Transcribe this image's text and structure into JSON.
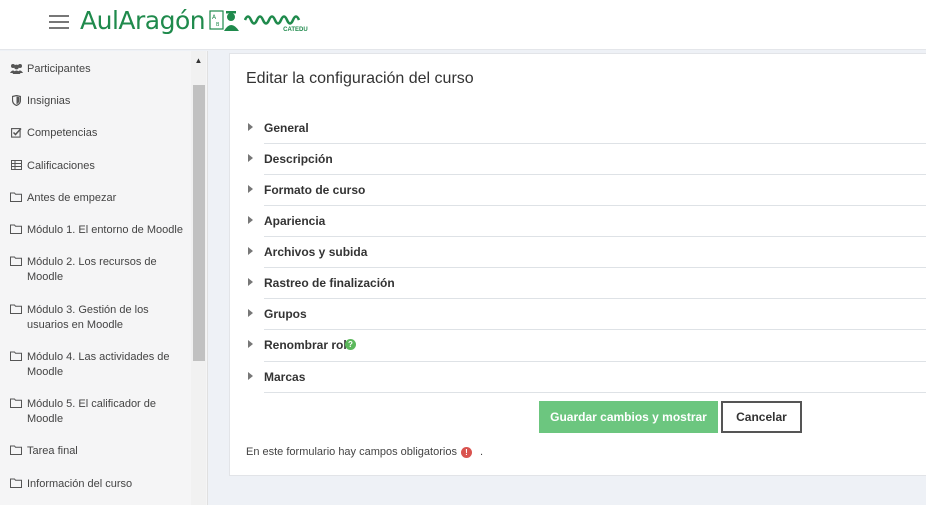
{
  "header": {
    "logo_text": "AulAragón",
    "logo_sub": "CATEDU",
    "menu_icon": "hamburger-icon"
  },
  "sidebar": {
    "items": [
      {
        "label": "Participantes",
        "icon": "users-icon"
      },
      {
        "label": "Insignias",
        "icon": "shield-icon"
      },
      {
        "label": "Competencias",
        "icon": "checkbox-icon"
      },
      {
        "label": "Calificaciones",
        "icon": "table-icon"
      },
      {
        "label": "Antes de empezar",
        "icon": "folder-icon"
      },
      {
        "label": "Módulo 1. El entorno de Moodle",
        "icon": "folder-icon"
      },
      {
        "label": "Módulo 2. Los recursos de Moodle",
        "icon": "folder-icon"
      },
      {
        "label": "Módulo 3. Gestión de los usuarios en Moodle",
        "icon": "folder-icon"
      },
      {
        "label": "Módulo 4. Las actividades de Moodle",
        "icon": "folder-icon"
      },
      {
        "label": "Módulo 5. El calificador de Moodle",
        "icon": "folder-icon"
      },
      {
        "label": "Tarea final",
        "icon": "folder-icon"
      },
      {
        "label": "Información del curso",
        "icon": "folder-icon"
      }
    ]
  },
  "main": {
    "title": "Editar la configuración del curso",
    "sections": [
      {
        "label": "General"
      },
      {
        "label": "Descripción"
      },
      {
        "label": "Formato de curso"
      },
      {
        "label": "Apariencia"
      },
      {
        "label": "Archivos y subida"
      },
      {
        "label": "Rastreo de finalización"
      },
      {
        "label": "Grupos"
      },
      {
        "label": "Renombrar rol",
        "help": true
      },
      {
        "label": "Marcas"
      }
    ],
    "save_label": "Guardar cambios y mostrar",
    "cancel_label": "Cancelar",
    "required_note": "En este formulario hay campos obligatorios",
    "required_suffix": ".",
    "colors": {
      "brand": "#1f8a4c",
      "save_button": "#6cc67f",
      "help": "#5cb85c",
      "required": "#d9534f"
    }
  }
}
